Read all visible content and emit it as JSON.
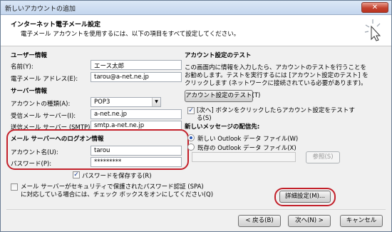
{
  "window": {
    "title": "新しいアカウントの追加",
    "close_label": "✕"
  },
  "header": {
    "title": "インターネット電子メール設定",
    "subtitle": "電子メール アカウントを使用するには、以下の項目をすべて設定してください。"
  },
  "user_info": {
    "heading": "ユーザー情報",
    "name_label": "名前(Y):",
    "name_value": "エース太郎",
    "email_label": "電子メール アドレス(E):",
    "email_value": "tarou@a-net.ne.jp"
  },
  "server_info": {
    "heading": "サーバー情報",
    "account_type_label": "アカウントの種類(A):",
    "account_type_value": "POP3",
    "incoming_label": "受信メール サーバー(I):",
    "incoming_value": "a-net.ne.jp",
    "outgoing_label": "送信メール サーバー (SMTP)(O):",
    "outgoing_value": "smtp.a-net.ne.jp"
  },
  "logon_info": {
    "heading": "メール サーバーへのログオン情報",
    "account_label": "アカウント名(U):",
    "account_value": "tarou",
    "password_label": "パスワード(P):",
    "password_value": "*********",
    "remember_label": "パスワードを保存する(R)"
  },
  "spa": {
    "label_line1": "メール サーバーがセキュリティで保護されたパスワード認証 (SPA)",
    "label_line2": "に対応している場合には、チェック ボックスをオンにしてください(Q)"
  },
  "test": {
    "heading": "アカウント設定のテスト",
    "desc_line1": "この画面内に情報を入力したら、アカウントのテストを行うことを",
    "desc_line2": "お勧めします。テストを実行するには [アカウント設定のテスト] を",
    "desc_line3": "クリックします (ネットワークに接続されている必要があります)。",
    "button_label": "アカウント設定のテスト(T)",
    "next_check_line1": "[次へ] ボタンをクリックしたらアカウント設定をテストす",
    "next_check_line2": "る(S)"
  },
  "delivery": {
    "heading": "新しいメッセージの配信先:",
    "new_file_label": "新しい Outlook データ ファイル(W)",
    "existing_file_label": "既存の Outlook データ ファイル(X)",
    "browse_label": "参照(S)"
  },
  "buttons": {
    "more_settings": "詳細設定(M)...",
    "back": "< 戻る(B)",
    "next": "次へ(N) >",
    "cancel": "キャンセル"
  },
  "colors": {
    "highlight_ring": "#c3202a",
    "title_bg": "#c4d6ee"
  }
}
